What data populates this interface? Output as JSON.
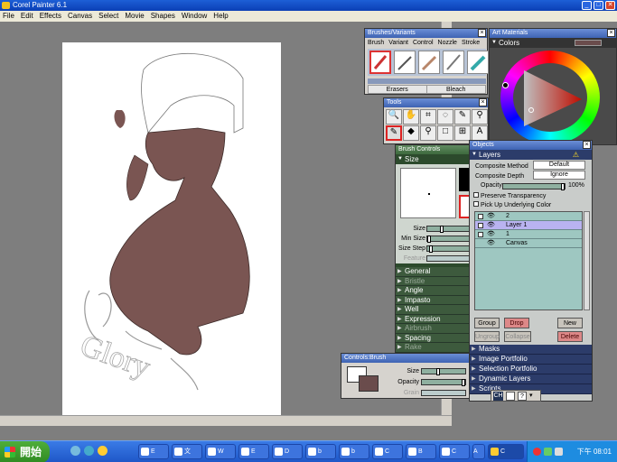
{
  "window": {
    "title": "Corel Painter 6.1"
  },
  "menu": [
    "File",
    "Edit",
    "Effects",
    "Canvas",
    "Select",
    "Movie",
    "Shapes",
    "Window",
    "Help"
  ],
  "brush_selector": {
    "title": "Brushes/Variants",
    "tabs": [
      "Brush",
      "Variant",
      "Control",
      "Nozzle",
      "Stroke"
    ],
    "categories": [
      "Erasers",
      "Bleach"
    ]
  },
  "colors": {
    "title": "Art Materials",
    "section": "Colors"
  },
  "tools": {
    "title": "Tools"
  },
  "brush_controls": {
    "title": "Brush Controls",
    "section": "Size",
    "size_labels": [
      "Size",
      "Min Size",
      "Size Step",
      "Feature"
    ],
    "categories": [
      {
        "label": "General",
        "dim": false
      },
      {
        "label": "Bristle",
        "dim": true
      },
      {
        "label": "Angle",
        "dim": false
      },
      {
        "label": "Impasto",
        "dim": false
      },
      {
        "label": "Well",
        "dim": false
      },
      {
        "label": "Expression",
        "dim": false
      },
      {
        "label": "Airbrush",
        "dim": true
      },
      {
        "label": "Spacing",
        "dim": false
      },
      {
        "label": "Rake",
        "dim": true
      }
    ]
  },
  "objects": {
    "title": "Objects",
    "section": "Layers",
    "composite_method_label": "Composite Method",
    "composite_method_value": "Default",
    "composite_depth_label": "Composite Depth",
    "composite_depth_value": "Ignore",
    "opacity_label": "Opacity",
    "opacity_value": "100%",
    "preserve_transparency": "Preserve Transparency",
    "pick_up_color": "Pick Up Underlying Color",
    "layers": [
      {
        "name": "2",
        "selected": false
      },
      {
        "name": "Layer 1",
        "selected": true
      },
      {
        "name": "1",
        "selected": false
      },
      {
        "name": "Canvas",
        "selected": false
      }
    ],
    "buttons": {
      "group": "Group",
      "drop": "Drop",
      "new": "New",
      "ungroup": "Ungroup",
      "collapse": "Collapse",
      "delete": "Delete"
    },
    "nav_sections": [
      "Masks",
      "Image Portfolio",
      "Selection Portfolio",
      "Dynamic Layers",
      "Scripts"
    ]
  },
  "controls_brush": {
    "title": "Controls:Brush",
    "size_label": "Size",
    "opacity_label": "Opacity",
    "grain_label": "Grain"
  },
  "taskbar": {
    "start": "開始",
    "tasks": [
      "E",
      "文",
      "W",
      "E",
      "D",
      "b",
      "b",
      "C",
      "B",
      "C",
      "A",
      "C"
    ],
    "clock": "下午 08:01"
  }
}
